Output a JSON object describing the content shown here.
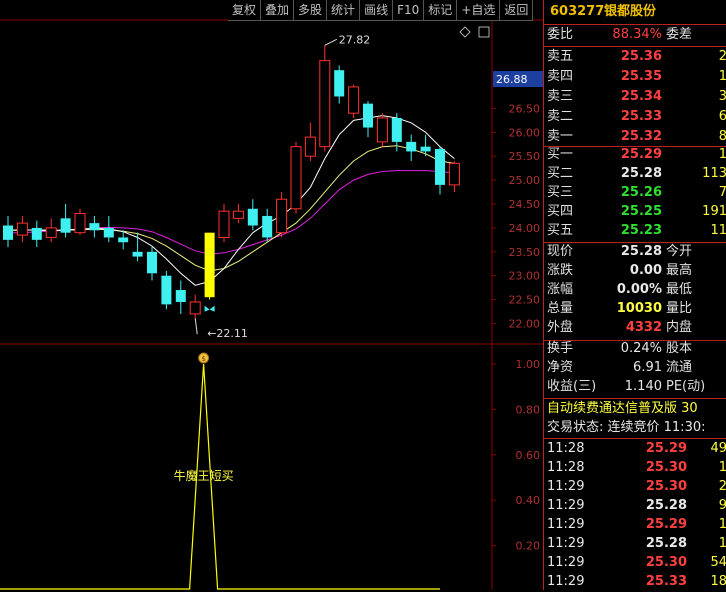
{
  "toolbar": {
    "buttons": [
      "复权",
      "叠加",
      "多股",
      "统计",
      "画线",
      "F10",
      "标记",
      "+自选",
      "返回"
    ]
  },
  "header": {
    "code": "603277",
    "name": "银都股份"
  },
  "ratio": {
    "label": "委比",
    "value": "88.34%",
    "diff_label": "委差"
  },
  "sell_orders": [
    {
      "label": "卖五",
      "price": "25.36",
      "volume": "2"
    },
    {
      "label": "卖四",
      "price": "25.35",
      "volume": "1"
    },
    {
      "label": "卖三",
      "price": "25.34",
      "volume": "3"
    },
    {
      "label": "卖二",
      "price": "25.33",
      "volume": "6"
    },
    {
      "label": "卖一",
      "price": "25.32",
      "volume": "8"
    }
  ],
  "buy_orders": [
    {
      "label": "买一",
      "price": "25.29",
      "volume": "1",
      "color": "#ff4040"
    },
    {
      "label": "买二",
      "price": "25.28",
      "volume": "113",
      "color": "#e8e8e8"
    },
    {
      "label": "买三",
      "price": "25.26",
      "volume": "7",
      "color": "#30e030"
    },
    {
      "label": "买四",
      "price": "25.25",
      "volume": "191",
      "color": "#30e030"
    },
    {
      "label": "买五",
      "price": "25.23",
      "volume": "11",
      "color": "#30e030"
    }
  ],
  "stats": [
    {
      "label": "现价",
      "value": "25.28",
      "color": "#e8e8e8",
      "label2": "今开"
    },
    {
      "label": "涨跌",
      "value": "0.00",
      "color": "#e8e8e8",
      "label2": "最高"
    },
    {
      "label": "涨幅",
      "value": "0.00%",
      "color": "#e8e8e8",
      "label2": "最低"
    },
    {
      "label": "总量",
      "value": "10030",
      "color": "#ffff40",
      "label2": "量比"
    },
    {
      "label": "外盘",
      "value": "4332",
      "color": "#ff4040",
      "label2": "内盘"
    }
  ],
  "stats2": [
    {
      "label": "换手",
      "value": "0.24%",
      "label2": "股本"
    },
    {
      "label": "净资",
      "value": "6.91",
      "label2": "流通"
    },
    {
      "label": "收益(三)",
      "value": "1.140",
      "label2": "PE(动)"
    }
  ],
  "ticker": "自动续费通达信普及版  30",
  "trade_state": "交易状态: 连续竞价 11:30:",
  "ticks": [
    {
      "time": "11:28",
      "price": "25.29",
      "vol": "49",
      "color": "#ff4040"
    },
    {
      "time": "11:28",
      "price": "25.30",
      "vol": "1",
      "color": "#ff4040"
    },
    {
      "time": "11:29",
      "price": "25.30",
      "vol": "2",
      "color": "#ff4040"
    },
    {
      "time": "11:29",
      "price": "25.28",
      "vol": "9",
      "color": "#e8e8e8"
    },
    {
      "time": "11:29",
      "price": "25.29",
      "vol": "1",
      "color": "#ff4040"
    },
    {
      "time": "11:29",
      "price": "25.28",
      "vol": "1",
      "color": "#e8e8e8"
    },
    {
      "time": "11:29",
      "price": "25.30",
      "vol": "54",
      "color": "#ff4040"
    },
    {
      "time": "11:29",
      "price": "25.33",
      "vol": "18",
      "color": "#ff4040"
    }
  ],
  "chart_data": [
    {
      "type": "candlestick",
      "title": "",
      "y_ticks": [
        "26.50",
        "26.00",
        "25.50",
        "25.00",
        "24.50",
        "24.00",
        "23.50",
        "23.00",
        "22.50",
        "22.00"
      ],
      "current_price_label": "26.88",
      "high_annotation": "27.82",
      "low_annotation": "22.11",
      "ylim": [
        21.8,
        28.0
      ],
      "candles": [
        {
          "o": 24.05,
          "c": 23.75,
          "h": 24.25,
          "l": 23.6
        },
        {
          "o": 23.85,
          "c": 24.1,
          "h": 24.25,
          "l": 23.7
        },
        {
          "o": 24.0,
          "c": 23.75,
          "h": 24.15,
          "l": 23.6
        },
        {
          "o": 23.8,
          "c": 24.0,
          "h": 24.2,
          "l": 23.7
        },
        {
          "o": 24.2,
          "c": 23.9,
          "h": 24.5,
          "l": 23.8
        },
        {
          "o": 23.9,
          "c": 24.3,
          "h": 24.4,
          "l": 23.85
        },
        {
          "o": 24.1,
          "c": 23.95,
          "h": 24.25,
          "l": 23.8
        },
        {
          "o": 24.0,
          "c": 23.8,
          "h": 24.25,
          "l": 23.7
        },
        {
          "o": 23.8,
          "c": 23.7,
          "h": 23.95,
          "l": 23.55
        },
        {
          "o": 23.5,
          "c": 23.4,
          "h": 23.9,
          "l": 23.3
        },
        {
          "o": 23.5,
          "c": 23.05,
          "h": 23.6,
          "l": 22.9
        },
        {
          "o": 23.0,
          "c": 22.4,
          "h": 23.1,
          "l": 22.3
        },
        {
          "o": 22.7,
          "c": 22.45,
          "h": 22.9,
          "l": 22.2
        },
        {
          "o": 22.2,
          "c": 22.45,
          "h": 22.6,
          "l": 22.11
        },
        {
          "o": 22.55,
          "c": 23.9,
          "h": 23.9,
          "l": 22.5
        },
        {
          "o": 23.8,
          "c": 24.35,
          "h": 24.5,
          "l": 23.7
        },
        {
          "o": 24.2,
          "c": 24.35,
          "h": 24.5,
          "l": 24.1
        },
        {
          "o": 24.4,
          "c": 24.05,
          "h": 24.6,
          "l": 23.95
        },
        {
          "o": 24.25,
          "c": 23.8,
          "h": 24.4,
          "l": 23.7
        },
        {
          "o": 23.9,
          "c": 24.6,
          "h": 24.75,
          "l": 23.8
        },
        {
          "o": 24.4,
          "c": 25.7,
          "h": 25.8,
          "l": 24.3
        },
        {
          "o": 25.5,
          "c": 25.9,
          "h": 26.2,
          "l": 25.4
        },
        {
          "o": 25.7,
          "c": 27.5,
          "h": 27.82,
          "l": 25.6
        },
        {
          "o": 27.3,
          "c": 26.75,
          "h": 27.4,
          "l": 26.6
        },
        {
          "o": 26.4,
          "c": 26.95,
          "h": 27.0,
          "l": 26.3
        },
        {
          "o": 26.6,
          "c": 26.1,
          "h": 26.65,
          "l": 25.9
        },
        {
          "o": 25.8,
          "c": 26.3,
          "h": 26.4,
          "l": 25.7
        },
        {
          "o": 26.3,
          "c": 25.8,
          "h": 26.4,
          "l": 25.6
        },
        {
          "o": 25.8,
          "c": 25.6,
          "h": 25.95,
          "l": 25.4
        },
        {
          "o": 25.7,
          "c": 25.6,
          "h": 25.95,
          "l": 25.5
        },
        {
          "o": 25.65,
          "c": 24.9,
          "h": 25.7,
          "l": 24.7
        },
        {
          "o": 24.9,
          "c": 25.35,
          "h": 25.4,
          "l": 24.75
        }
      ],
      "ma_white": [
        23.95,
        23.96,
        23.95,
        23.94,
        23.96,
        23.97,
        23.99,
        23.98,
        23.92,
        23.8,
        23.62,
        23.35,
        23.05,
        22.8,
        22.88,
        23.15,
        23.55,
        23.9,
        24.1,
        24.25,
        24.5,
        24.85,
        25.45,
        25.95,
        26.25,
        26.3,
        26.35,
        26.3,
        26.2,
        26.0,
        25.7,
        25.45
      ],
      "ma_yellow": [
        23.95,
        23.95,
        23.96,
        23.95,
        23.95,
        23.96,
        23.97,
        23.96,
        23.93,
        23.88,
        23.78,
        23.62,
        23.42,
        23.22,
        23.1,
        23.15,
        23.3,
        23.5,
        23.7,
        23.9,
        24.1,
        24.4,
        24.75,
        25.1,
        25.4,
        25.6,
        25.7,
        25.72,
        25.65,
        25.55,
        25.4,
        25.35
      ],
      "ma_magenta": [
        23.9,
        23.9,
        23.92,
        23.93,
        23.95,
        23.97,
        24.0,
        24.01,
        24.0,
        23.98,
        23.92,
        23.8,
        23.66,
        23.52,
        23.45,
        23.48,
        23.55,
        23.65,
        23.75,
        23.85,
        23.98,
        24.2,
        24.5,
        24.8,
        25.0,
        25.12,
        25.18,
        25.2,
        25.2,
        25.2,
        25.18,
        25.15
      ],
      "signal_candle_index": 14
    },
    {
      "type": "line",
      "title": "",
      "y_ticks": [
        "1.00",
        "0.80",
        "0.60",
        "0.40",
        "0.20"
      ],
      "ylim": [
        0,
        1.1
      ],
      "annotation": "牛魔王短买",
      "signal_peak": 1.0
    }
  ]
}
